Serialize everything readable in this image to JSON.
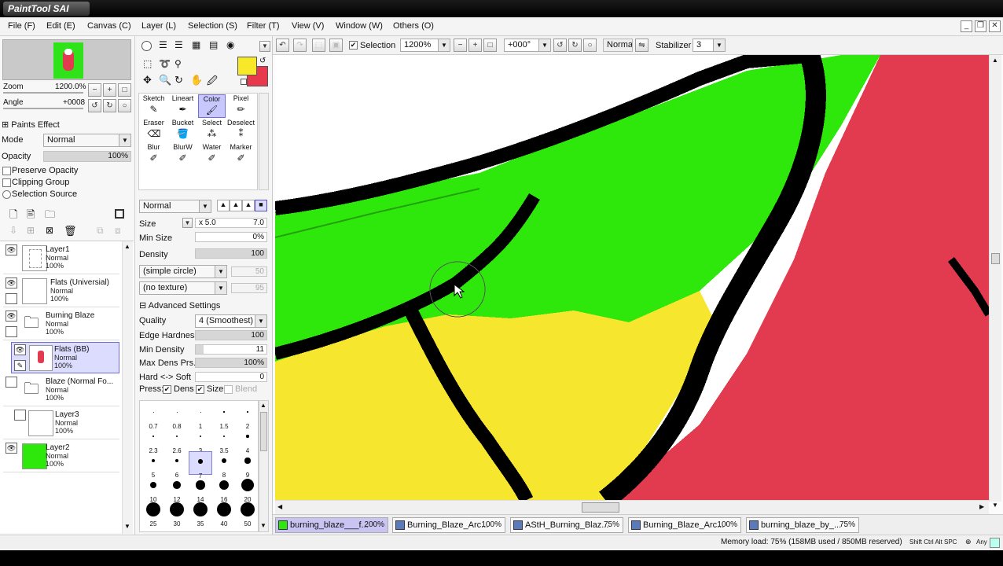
{
  "app": {
    "logo_text": "PaintTool SAI"
  },
  "menu": [
    "File (F)",
    "Edit (E)",
    "Canvas (C)",
    "Layer (L)",
    "Selection (S)",
    "Filter (T)",
    "View (V)",
    "Window (W)",
    "Others (O)"
  ],
  "nav": {
    "zoom_label": "Zoom",
    "zoom_value": "1200.0%",
    "angle_label": "Angle",
    "angle_value": "+0008"
  },
  "paints_effect": {
    "title": "Paints Effect",
    "mode_label": "Mode",
    "mode_value": "Normal",
    "opacity_label": "Opacity",
    "opacity_value": "100%"
  },
  "layer_options": [
    "Preserve Opacity",
    "Clipping Group",
    "Selection Source"
  ],
  "layers": [
    {
      "name": "Layer1",
      "mode": "Normal",
      "opacity": "100%"
    },
    {
      "name": "Flats (Universial)",
      "mode": "Normal",
      "opacity": "100%"
    },
    {
      "name": "Burning Blaze",
      "mode": "Normal",
      "opacity": "100%"
    },
    {
      "name": "Flats (BB)",
      "mode": "Normal",
      "opacity": "100%"
    },
    {
      "name": "Blaze (Normal Fo...",
      "mode": "Normal",
      "opacity": "100%"
    },
    {
      "name": "Layer3",
      "mode": "Normal",
      "opacity": "100%"
    },
    {
      "name": "Layer2",
      "mode": "Normal",
      "opacity": "100%"
    }
  ],
  "colors": {
    "primary": "#f7e928",
    "secondary": "#e8384e",
    "canvas_green": "#2ee80c",
    "canvas_yellow": "#f6e62e",
    "canvas_red": "#e23a4e"
  },
  "tools": [
    {
      "label": "Sketch",
      "icon": "pencil-icon"
    },
    {
      "label": "Lineart",
      "icon": "pen-icon"
    },
    {
      "label": "Color",
      "icon": "brush-icon"
    },
    {
      "label": "Pixel",
      "icon": "pixel-pen-icon"
    },
    {
      "label": "Eraser",
      "icon": "eraser-icon"
    },
    {
      "label": "Bucket",
      "icon": "bucket-icon"
    },
    {
      "label": "Select",
      "icon": "select-pen-icon"
    },
    {
      "label": "Deselect",
      "icon": "deselect-pen-icon"
    },
    {
      "label": "Blur",
      "icon": "blur-icon"
    },
    {
      "label": "BlurW",
      "icon": "blurw-icon"
    },
    {
      "label": "Water",
      "icon": "water-icon"
    },
    {
      "label": "Marker",
      "icon": "marker-icon"
    }
  ],
  "brush": {
    "blend_mode": "Normal",
    "size_label": "Size",
    "size_mult": "x 5.0",
    "size_value": "7.0",
    "min_size_label": "Min Size",
    "min_size_value": "0%",
    "density_label": "Density",
    "density_value": "100",
    "shape": "(simple circle)",
    "shape_value": "50",
    "texture": "(no texture)",
    "texture_value": "95",
    "advanced_label": "Advanced Settings",
    "quality_label": "Quality",
    "quality_value": "4 (Smoothest)",
    "edge_label": "Edge Hardness",
    "edge_value": "100",
    "min_density_label": "Min Density",
    "min_density_value": "11",
    "max_dens_label": "Max Dens Prs.",
    "max_dens_value": "100%",
    "hardsoft_label": "Hard <-> Soft",
    "hardsoft_value": "0",
    "press_label": "Press:",
    "press_dens": "Dens",
    "press_size": "Size",
    "press_blend": "Blend"
  },
  "brush_sizes": [
    "0.7",
    "0.8",
    "1",
    "1.5",
    "2",
    "2.3",
    "2.6",
    "3",
    "3.5",
    "4",
    "5",
    "6",
    "7",
    "8",
    "9",
    "10",
    "12",
    "14",
    "16",
    "20",
    "25",
    "30",
    "35",
    "40",
    "50"
  ],
  "toolbar": {
    "selection_label": "Selection",
    "zoom": "1200%",
    "angle": "+000°",
    "blend": "Normal",
    "stabilizer_label": "Stabilizer",
    "stabilizer_value": "3"
  },
  "tabs": [
    {
      "name": "burning_blaze___f...",
      "zoom": "200%"
    },
    {
      "name": "Burning_Blaze_Arc...",
      "zoom": "100%"
    },
    {
      "name": "AStH_Burning_Blaz...",
      "zoom": "75%"
    },
    {
      "name": "Burning_Blaze_Arc...",
      "zoom": "100%"
    },
    {
      "name": "burning_blaze_by_...",
      "zoom": "75%"
    }
  ],
  "status": {
    "memory": "Memory load: 75% (158MB used / 850MB reserved)",
    "keys": "Shift Ctrl Alt SPC",
    "any": "Any"
  }
}
